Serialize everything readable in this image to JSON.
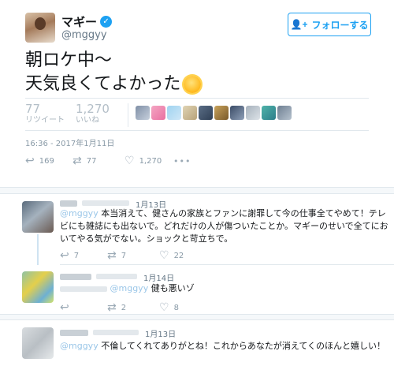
{
  "tweet": {
    "display_name": "マギー",
    "handle": "@mggyy",
    "follow_label": "フォローする",
    "text_line1": "朝ロケ中〜",
    "text_line2": "天気良くてよかった",
    "retweets_count": "77",
    "retweets_label": "リツイート",
    "likes_count": "1,270",
    "likes_label": "いいね",
    "timestamp": "16:36 - 2017年1月11日",
    "actions": {
      "reply_count": "169",
      "retweet_count": "77",
      "like_count": "1,270",
      "more": "•••"
    }
  },
  "replies": [
    {
      "date": "1月13日",
      "mention": "@mggyy",
      "text": "本当消えて、健さんの家族とファンに謝罪して今の仕事全てやめて！テレビにも雑誌にも出ないで。どれだけの人が傷ついたことか。マギーのせいで全てにおいてやる気がでない。ショックと苛立ちで。",
      "reply_count": "7",
      "retweet_count": "7",
      "like_count": "22"
    },
    {
      "date": "1月14日",
      "mention": "@mggyy",
      "text": "健も悪いゾ",
      "reply_count": "",
      "retweet_count": "2",
      "like_count": "8"
    },
    {
      "date": "1月13日",
      "mention": "@mggyy",
      "text": "不倫してくれてありがとね！これからあなたが消えてくのほんと嬉しい！"
    }
  ],
  "colors": {
    "twitter_blue": "#1da1f2",
    "muted_text": "#657786",
    "mention_blue": "#9ac6e8"
  }
}
